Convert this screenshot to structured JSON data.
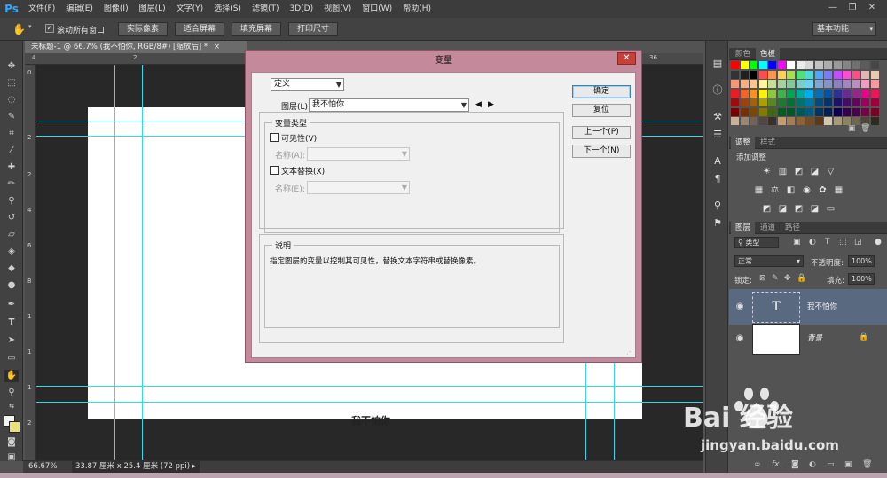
{
  "app": {
    "logo": "Ps"
  },
  "menu": [
    "文件(F)",
    "编辑(E)",
    "图像(I)",
    "图层(L)",
    "文字(Y)",
    "选择(S)",
    "滤镜(T)",
    "3D(D)",
    "视图(V)",
    "窗口(W)",
    "帮助(H)"
  ],
  "window_controls": {
    "minimize": "—",
    "restore": "❐",
    "close": "✕"
  },
  "options": {
    "scroll_all_label": "滚动所有窗口",
    "scroll_all_checked": true,
    "buttons": [
      "实际像素",
      "适合屏幕",
      "填充屏幕",
      "打印尺寸"
    ],
    "workspace": "基本功能"
  },
  "document": {
    "tab_title": "未标题-1 @ 66.7% (我不怕你, RGB/8#) [缩放后] *",
    "tab_close": "×",
    "canvas_text": "我不怕你",
    "ruler_top_numbers": [
      "4",
      "2",
      "36"
    ],
    "ruler_left_numbers": [
      "0",
      "2",
      "2",
      "4",
      "6",
      "8",
      "1",
      "1",
      "1",
      "2"
    ]
  },
  "status": {
    "zoom": "66.67%",
    "doc_size": "33.87 厘米 x 25.4 厘米 (72 ppi)"
  },
  "panels": {
    "color_tabs": [
      "颜色",
      "色板"
    ],
    "adjust_tabs": [
      "调整",
      "样式"
    ],
    "adjust_title": "添加调整",
    "layers_tabs": [
      "图层",
      "通道",
      "路径"
    ],
    "filter_kind": "类型",
    "blend_mode": "正常",
    "opacity_label": "不透明度:",
    "opacity_value": "100%",
    "lock_label": "锁定:",
    "fill_label": "填充:",
    "fill_value": "100%",
    "layers": [
      {
        "name": "我不怕你",
        "type": "text",
        "thumb_glyph": "T",
        "selected": true
      },
      {
        "name": "背景",
        "type": "background",
        "locked": true,
        "selected": false
      }
    ]
  },
  "dialog": {
    "title": "变量",
    "close": "✕",
    "define_select": "定义",
    "layer_label": "图层(L):",
    "layer_value": "我不怕你",
    "nav_prev": "◀",
    "nav_next": "▶",
    "var_type_group": "变量类型",
    "visibility_label": "可见性(V)",
    "visibility_checked": false,
    "name_a_label": "名称(A):",
    "text_replace_label": "文本替换(X)",
    "text_replace_checked": false,
    "name_e_label": "名称(E):",
    "desc_group": "说明",
    "desc_text": "指定图层的变量以控制其可见性，替换文本字符串或替换像素。",
    "buttons": {
      "ok": "确定",
      "reset": "复位",
      "prev": "上一个(P)",
      "next": "下一个(N)"
    }
  },
  "watermark": {
    "brand": "Bai 经验",
    "url": "jingyan.baidu.com"
  },
  "colors": {
    "accent": "#35d8e8",
    "dialog_frame": "#c4899a",
    "ps_blue": "#31a8ff"
  }
}
